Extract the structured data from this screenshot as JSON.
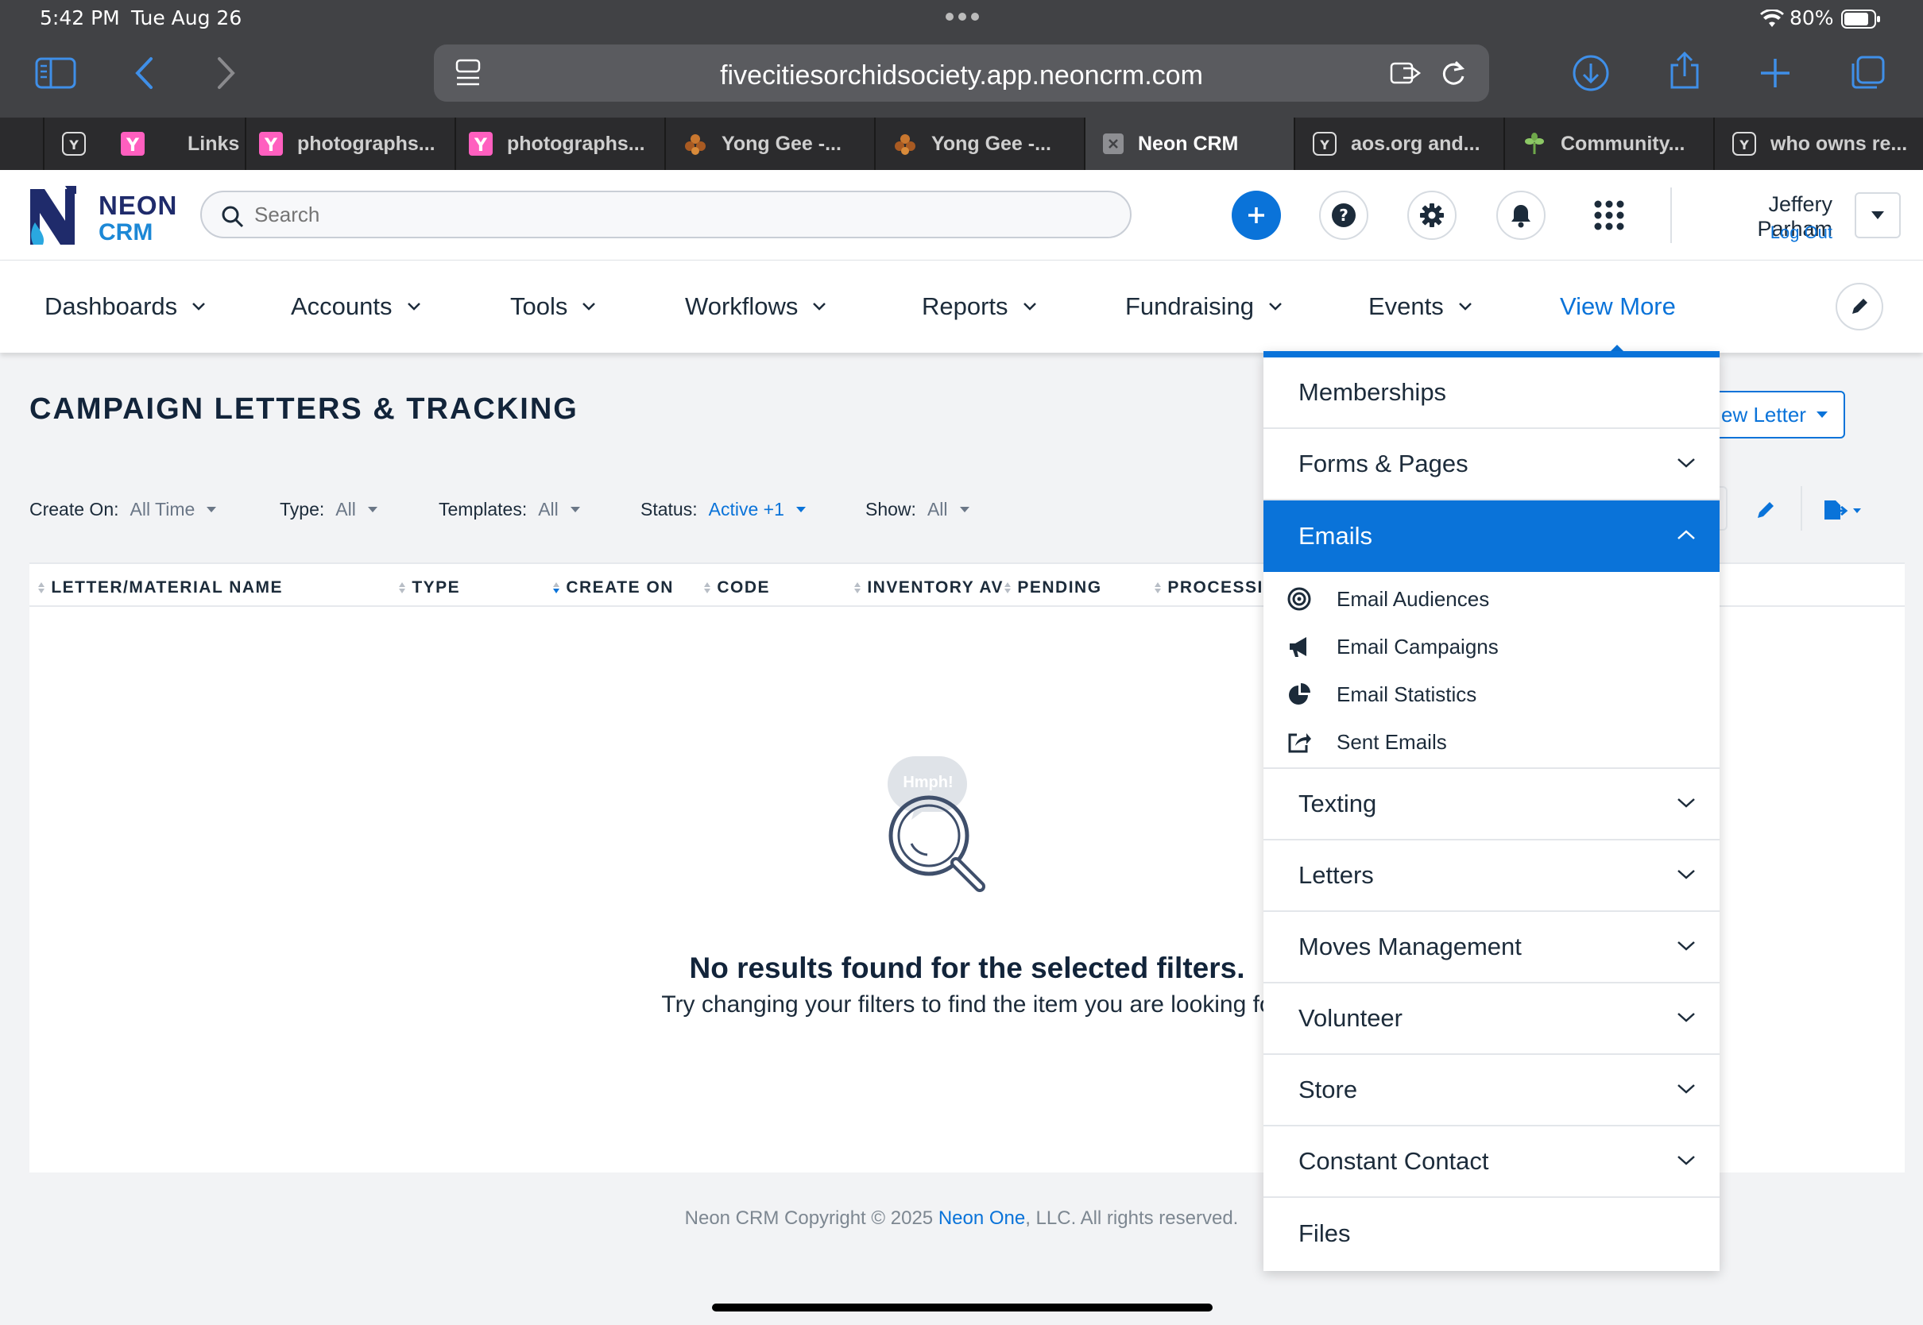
{
  "status_bar": {
    "time": "5:42 PM",
    "date": "Tue Aug 26",
    "battery": "80%"
  },
  "browser": {
    "url": "fivecitiesorchidsociety.app.neoncrm.com",
    "tabs": [
      {
        "label": ""
      },
      {
        "label": "Links"
      },
      {
        "label": "photographs..."
      },
      {
        "label": "photographs..."
      },
      {
        "label": "Yong Gee -..."
      },
      {
        "label": "Yong Gee -..."
      },
      {
        "label": "Neon CRM"
      },
      {
        "label": "aos.org and..."
      },
      {
        "label": "Community..."
      },
      {
        "label": "who owns re..."
      }
    ]
  },
  "header": {
    "logo_top": "NEON",
    "logo_bottom": "CRM",
    "search_placeholder": "Search",
    "user_name": "Jeffery Parham",
    "logout": "Log Out"
  },
  "nav": {
    "items": [
      "Dashboards",
      "Accounts",
      "Tools",
      "Workflows",
      "Reports",
      "Fundraising",
      "Events"
    ],
    "view_more": "View More"
  },
  "page": {
    "title": "CAMPAIGN LETTERS & TRACKING",
    "new_letter_button": "ew Letter",
    "filters": [
      {
        "label": "Create On:",
        "value": "All Time"
      },
      {
        "label": "Type:",
        "value": "All"
      },
      {
        "label": "Templates:",
        "value": "All"
      },
      {
        "label": "Status:",
        "value": "Active +1"
      },
      {
        "label": "Show:",
        "value": "All"
      }
    ],
    "columns": [
      "LETTER/MATERIAL NAME",
      "TYPE",
      "CREATE ON",
      "CODE",
      "INVENTORY AV",
      "PENDING",
      "PROCESSIN"
    ],
    "empty_bubble": "Hmph!",
    "empty_title": "No results found for the selected filters.",
    "empty_subtitle": "Try changing your filters to find the item you are looking fo"
  },
  "footer": {
    "prefix": "Neon CRM Copyright © 2025 ",
    "link": "Neon One",
    "suffix": ", LLC. All rights reserved."
  },
  "dropdown": {
    "memberships": "Memberships",
    "forms_pages": "Forms & Pages",
    "emails": "Emails",
    "email_subitems": [
      {
        "label": "Email Audiences",
        "icon": "target-icon"
      },
      {
        "label": "Email Campaigns",
        "icon": "megaphone-icon"
      },
      {
        "label": "Email Statistics",
        "icon": "pie-chart-icon"
      },
      {
        "label": "Sent Emails",
        "icon": "share-icon"
      }
    ],
    "texting": "Texting",
    "letters": "Letters",
    "moves_management": "Moves Management",
    "volunteer": "Volunteer",
    "store": "Store",
    "constant_contact": "Constant Contact",
    "files": "Files"
  },
  "colors": {
    "accent": "#0a73d9",
    "navy": "#12243a",
    "browser_chrome": "#414245"
  }
}
